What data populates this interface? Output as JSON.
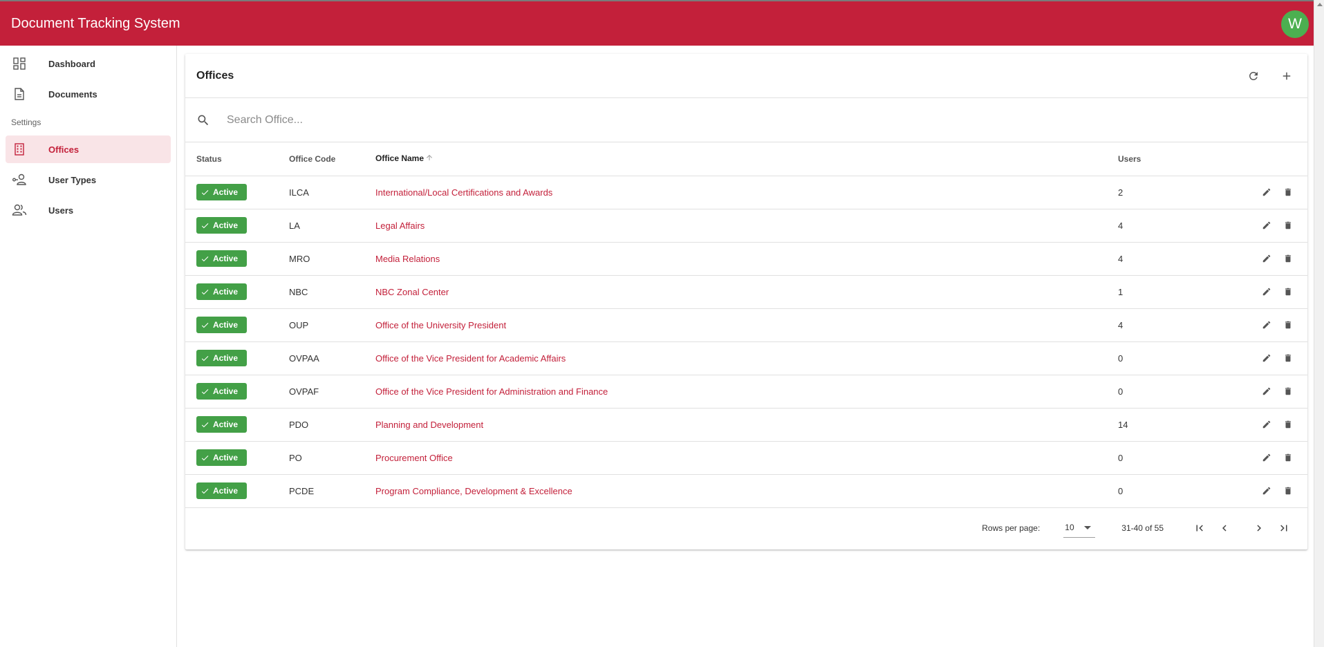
{
  "app": {
    "title": "Document Tracking System",
    "avatar_letter": "W"
  },
  "sidebar": {
    "items_top": [
      {
        "label": "Dashboard",
        "icon": "dashboard-icon"
      },
      {
        "label": "Documents",
        "icon": "document-icon"
      }
    ],
    "section_label": "Settings",
    "items_settings": [
      {
        "label": "Offices",
        "icon": "building-icon",
        "active": true
      },
      {
        "label": "User Types",
        "icon": "user-types-icon"
      },
      {
        "label": "Users",
        "icon": "users-icon"
      }
    ]
  },
  "card": {
    "title": "Offices",
    "refresh_icon": "refresh-icon",
    "add_icon": "plus-icon",
    "search": {
      "placeholder": "Search Office...",
      "value": ""
    }
  },
  "table": {
    "columns": {
      "status": "Status",
      "code": "Office Code",
      "name": "Office Name",
      "users": "Users"
    },
    "sorted_by": "Office Name",
    "rows": [
      {
        "status": "Active",
        "code": "ILCA",
        "name": "International/Local Certifications and Awards",
        "users": "2"
      },
      {
        "status": "Active",
        "code": "LA",
        "name": "Legal Affairs",
        "users": "4"
      },
      {
        "status": "Active",
        "code": "MRO",
        "name": "Media Relations",
        "users": "4"
      },
      {
        "status": "Active",
        "code": "NBC",
        "name": "NBC Zonal Center",
        "users": "1"
      },
      {
        "status": "Active",
        "code": "OUP",
        "name": "Office of the University President",
        "users": "4"
      },
      {
        "status": "Active",
        "code": "OVPAA",
        "name": "Office of the Vice President for Academic Affairs",
        "users": "0"
      },
      {
        "status": "Active",
        "code": "OVPAF",
        "name": "Office of the Vice President for Administration and Finance",
        "users": "0"
      },
      {
        "status": "Active",
        "code": "PDO",
        "name": "Planning and Development",
        "users": "14"
      },
      {
        "status": "Active",
        "code": "PO",
        "name": "Procurement Office",
        "users": "0"
      },
      {
        "status": "Active",
        "code": "PCDE",
        "name": "Program Compliance, Development & Excellence",
        "users": "0"
      }
    ]
  },
  "pagination": {
    "rows_per_page_label": "Rows per page:",
    "rows_per_page": "10",
    "range": "31-40 of 55"
  },
  "colors": {
    "brand": "#c3203a",
    "active_badge": "#43a047",
    "avatar": "#4caf50"
  }
}
